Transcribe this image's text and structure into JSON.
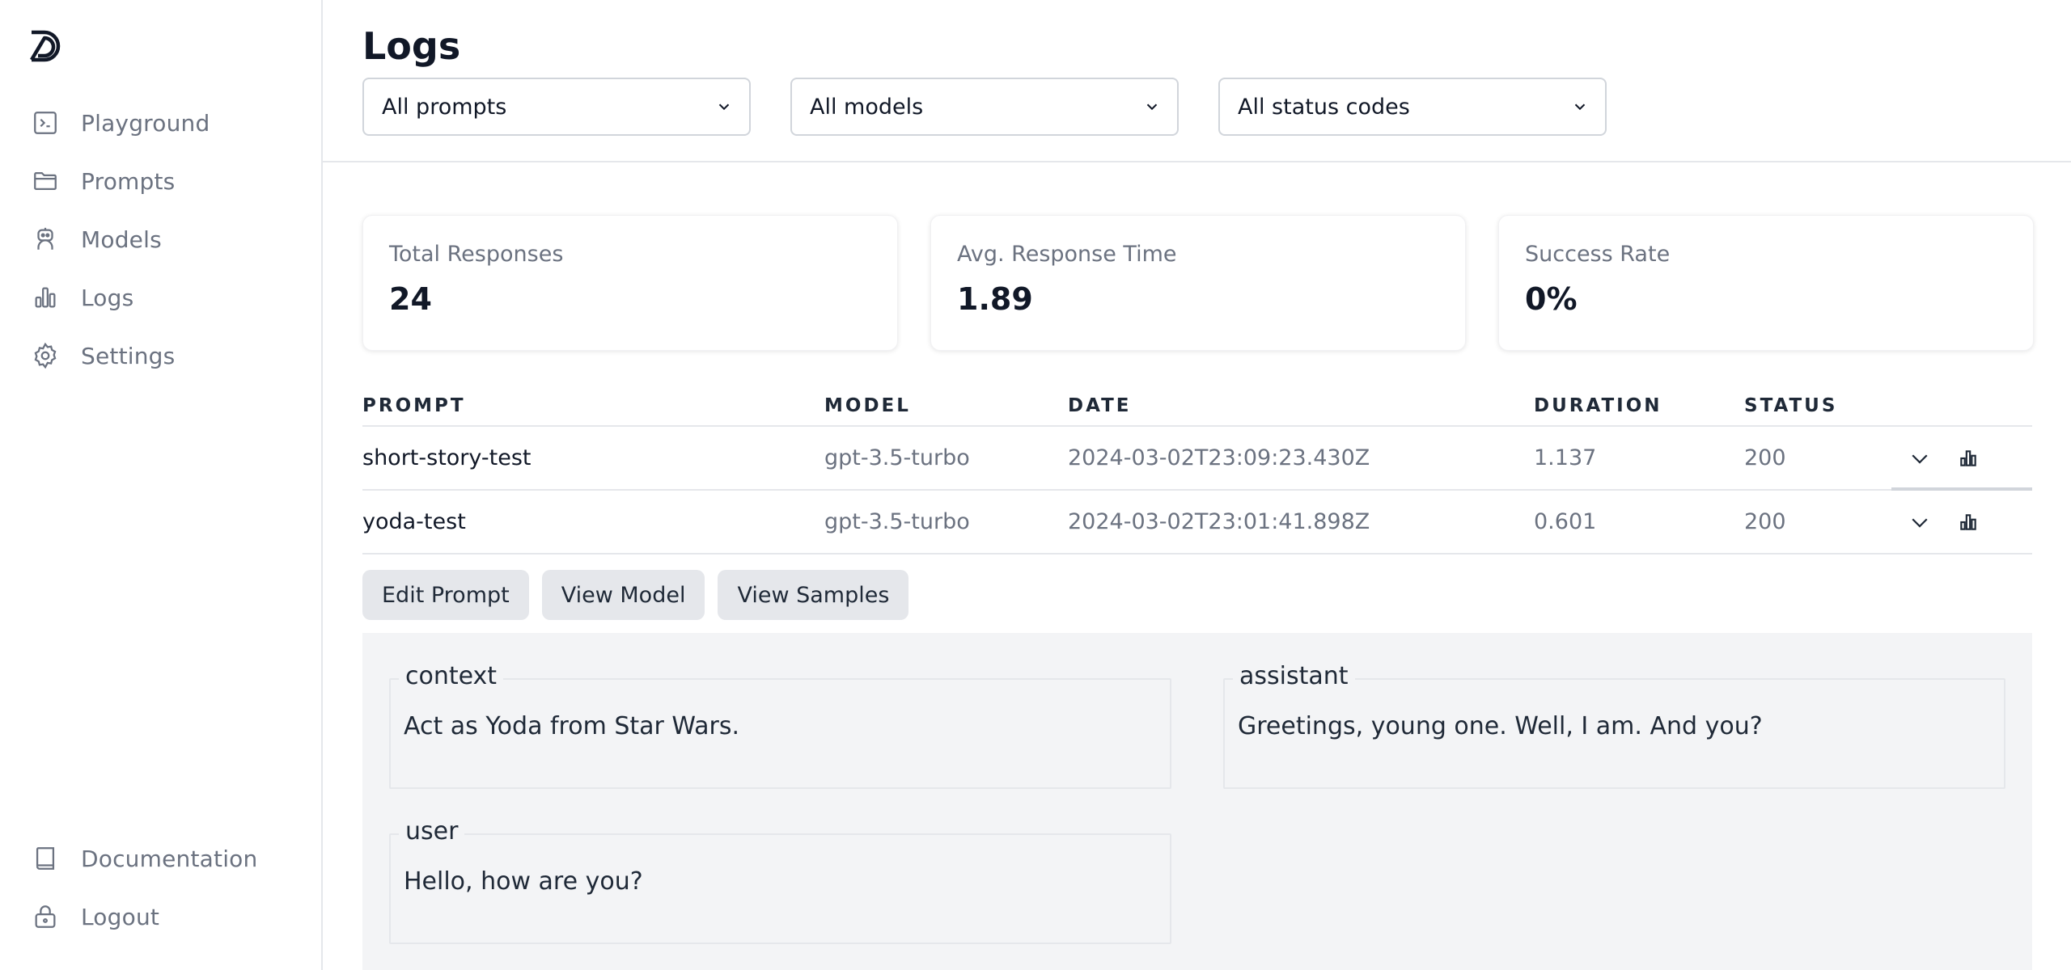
{
  "sidebar": {
    "logo_icon": "brand-logo",
    "items": [
      {
        "label": "Playground",
        "icon": "terminal-icon"
      },
      {
        "label": "Prompts",
        "icon": "folder-icon"
      },
      {
        "label": "Models",
        "icon": "robot-icon"
      },
      {
        "label": "Logs",
        "icon": "bar-chart-icon"
      },
      {
        "label": "Settings",
        "icon": "gear-icon"
      }
    ],
    "bottom_items": [
      {
        "label": "Documentation",
        "icon": "book-icon"
      },
      {
        "label": "Logout",
        "icon": "lock-icon"
      }
    ]
  },
  "header": {
    "title": "Logs",
    "filters": {
      "prompts": "All prompts",
      "models": "All models",
      "status": "All status codes"
    }
  },
  "stats": [
    {
      "label": "Total Responses",
      "value": "24"
    },
    {
      "label": "Avg. Response Time",
      "value": "1.89"
    },
    {
      "label": "Success Rate",
      "value": "0%"
    }
  ],
  "table": {
    "columns": [
      "PROMPT",
      "MODEL",
      "DATE",
      "DURATION",
      "STATUS"
    ],
    "rows": [
      {
        "prompt": "short-story-test",
        "model": "gpt-3.5-turbo",
        "date": "2024-03-02T23:09:23.430Z",
        "duration": "1.137",
        "status": "200"
      },
      {
        "prompt": "yoda-test",
        "model": "gpt-3.5-turbo",
        "date": "2024-03-02T23:01:41.898Z",
        "duration": "0.601",
        "status": "200"
      }
    ]
  },
  "actions": {
    "edit_prompt": "Edit Prompt",
    "view_model": "View Model",
    "view_samples": "View Samples"
  },
  "messages": [
    {
      "role": "context",
      "content": "Act as Yoda from Star Wars."
    },
    {
      "role": "assistant",
      "content": "Greetings, young one. Well, I am. And you?"
    },
    {
      "role": "user",
      "content": "Hello, how are you?"
    }
  ],
  "colors": {
    "muted_text": "#6b7280",
    "border": "#e5e7eb",
    "panel_bg": "#f3f4f6"
  }
}
